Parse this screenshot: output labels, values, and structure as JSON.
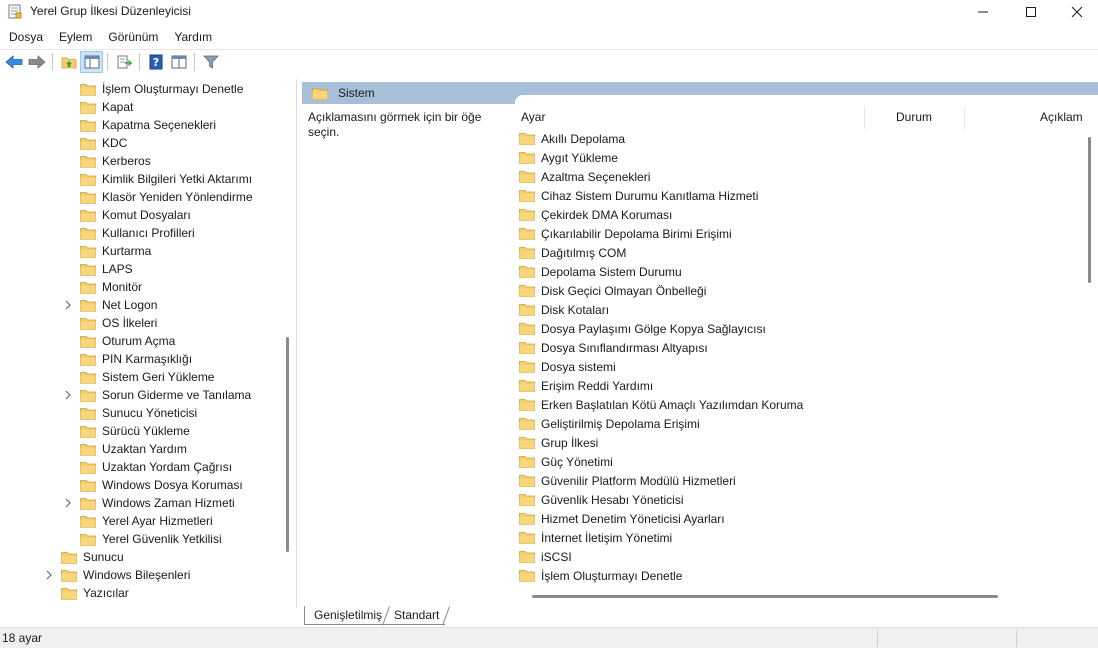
{
  "window": {
    "title": "Yerel Grup İlkesi Düzenleyicisi"
  },
  "menu": [
    "Dosya",
    "Eylem",
    "Görünüm",
    "Yardım"
  ],
  "toolbar": {
    "icons": [
      "back-arrow-icon",
      "forward-arrow-icon",
      "up-folder-icon",
      "show-hide-tree-icon",
      "export-list-icon",
      "help-icon",
      "extended-view-icon",
      "filter-icon"
    ]
  },
  "tree": {
    "items": [
      {
        "label": "İşlem Oluşturmayı Denetle",
        "level": 2,
        "expandable": false
      },
      {
        "label": "Kapat",
        "level": 2,
        "expandable": false
      },
      {
        "label": "Kapatma Seçenekleri",
        "level": 2,
        "expandable": false
      },
      {
        "label": "KDC",
        "level": 2,
        "expandable": false
      },
      {
        "label": "Kerberos",
        "level": 2,
        "expandable": false
      },
      {
        "label": "Kimlik Bilgileri Yetki Aktarımı",
        "level": 2,
        "expandable": false
      },
      {
        "label": "Klasör Yeniden Yönlendirme",
        "level": 2,
        "expandable": false
      },
      {
        "label": "Komut Dosyaları",
        "level": 2,
        "expandable": false
      },
      {
        "label": "Kullanıcı Profilleri",
        "level": 2,
        "expandable": false
      },
      {
        "label": "Kurtarma",
        "level": 2,
        "expandable": false
      },
      {
        "label": "LAPS",
        "level": 2,
        "expandable": false
      },
      {
        "label": "Monitör",
        "level": 2,
        "expandable": false
      },
      {
        "label": "Net Logon",
        "level": 2,
        "expandable": true
      },
      {
        "label": "OS İlkeleri",
        "level": 2,
        "expandable": false
      },
      {
        "label": "Oturum Açma",
        "level": 2,
        "expandable": false
      },
      {
        "label": "PIN Karmaşıklığı",
        "level": 2,
        "expandable": false
      },
      {
        "label": "Sistem Geri Yükleme",
        "level": 2,
        "expandable": false
      },
      {
        "label": "Sorun Giderme ve Tanılama",
        "level": 2,
        "expandable": true
      },
      {
        "label": "Sunucu Yöneticisi",
        "level": 2,
        "expandable": false
      },
      {
        "label": "Sürücü Yükleme",
        "level": 2,
        "expandable": false
      },
      {
        "label": "Uzaktan Yardım",
        "level": 2,
        "expandable": false
      },
      {
        "label": "Uzaktan Yordam Çağrısı",
        "level": 2,
        "expandable": false
      },
      {
        "label": "Windows Dosya Koruması",
        "level": 2,
        "expandable": false
      },
      {
        "label": "Windows Zaman Hizmeti",
        "level": 2,
        "expandable": true
      },
      {
        "label": "Yerel Ayar Hizmetleri",
        "level": 2,
        "expandable": false
      },
      {
        "label": "Yerel Güvenlik Yetkilisi",
        "level": 2,
        "expandable": false
      },
      {
        "label": "Sunucu",
        "level": 1,
        "expandable": false
      },
      {
        "label": "Windows Bileşenleri",
        "level": 1,
        "expandable": true
      },
      {
        "label": "Yazıcılar",
        "level": 1,
        "expandable": false
      }
    ]
  },
  "right": {
    "header_title": "Sistem",
    "description": "Açıklamasını görmek için bir öğe seçin.",
    "columns": [
      "Ayar",
      "Durum",
      "Açıklam"
    ],
    "items": [
      "Akıllı Depolama",
      "Aygıt Yükleme",
      "Azaltma Seçenekleri",
      "Cihaz Sistem Durumu Kanıtlama Hizmeti",
      "Çekirdek DMA Koruması",
      "Çıkarılabilir Depolama Birimi Erişimi",
      "Dağıtılmış COM",
      "Depolama Sistem Durumu",
      "Disk Geçici Olmayan Önbelleği",
      "Disk Kotaları",
      "Dosya Paylaşımı Gölge Kopya Sağlayıcısı",
      "Dosya Sınıflandırması Altyapısı",
      "Dosya sistemi",
      "Erişim Reddi Yardımı",
      "Erken Başlatılan Kötü Amaçlı Yazılımdan Koruma",
      "Geliştirilmiş Depolama Erişimi",
      "Grup İlkesi",
      "Güç Yönetimi",
      "Güvenilir Platform Modülü Hizmetleri",
      "Güvenlik Hesabı Yöneticisi",
      "Hizmet Denetim Yöneticisi Ayarları",
      "İnternet İletişim Yönetimi",
      "iSCSI",
      "İşlem Oluşturmayı Denetle"
    ]
  },
  "tabs": [
    "Genişletilmiş",
    "Standart"
  ],
  "status": {
    "text": "18 ayar"
  },
  "colors": {
    "header_band": "#a8bfda",
    "folder": "#f5cd6a",
    "toolbar_active": "#cce4f7"
  }
}
